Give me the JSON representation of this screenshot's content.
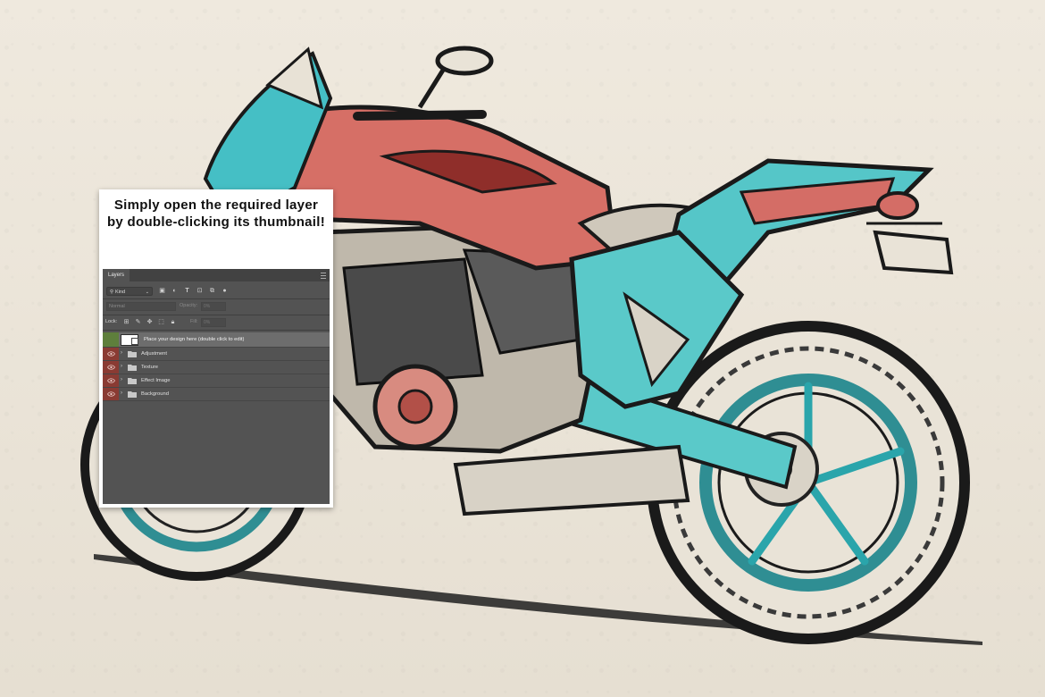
{
  "callout": {
    "text": "Simply open the required layer by double-clicking its thumbnail!"
  },
  "layers_panel": {
    "tab_label": "Layers",
    "filter": {
      "kind_label": "Kind",
      "icons": [
        "image-filter-icon",
        "adjustment-filter-icon",
        "type-filter-icon",
        "shape-filter-icon",
        "smart-object-filter-icon",
        "filter-toggle-icon"
      ]
    },
    "blend_mode": "Normal",
    "opacity_label": "Opacity:",
    "opacity_value": "0%",
    "lock_label": "Lock:",
    "lock_icons": [
      "lock-transparent-pixels-icon",
      "lock-image-pixels-icon",
      "lock-position-icon",
      "lock-artboard-icon",
      "lock-all-icon"
    ],
    "fill_label": "Fill:",
    "fill_value": "0%",
    "layers": [
      {
        "name": "Place your design here (double click to edit)",
        "type": "smart-object",
        "selected": true
      },
      {
        "name": "Adjustment",
        "type": "group"
      },
      {
        "name": "Texture",
        "type": "group"
      },
      {
        "name": "Effect Image",
        "type": "group"
      },
      {
        "name": "Background",
        "type": "group"
      }
    ]
  },
  "colors": {
    "teal": "#49c3c3",
    "red": "#c65a52",
    "panel_bg": "#535353",
    "eye_red": "#8a3b33",
    "eye_green": "#5e7f3c"
  }
}
